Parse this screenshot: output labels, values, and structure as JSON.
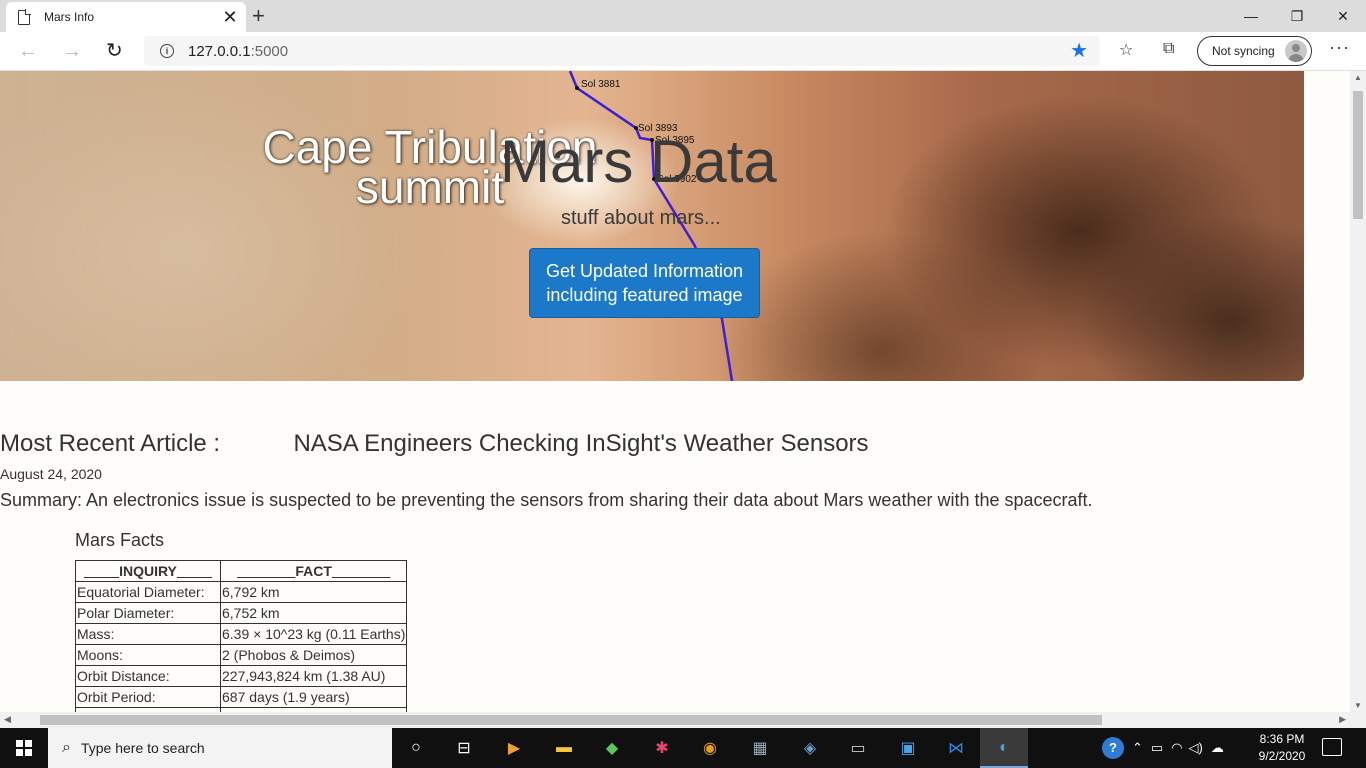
{
  "browser": {
    "tab_title": "Mars Info",
    "tab_close": "✕",
    "new_tab": "+",
    "window_controls": {
      "minimize": "—",
      "restore": "❐",
      "close": "✕"
    },
    "url_host": "127.0.0.1",
    "url_port": ":5000",
    "sync_label": "Not syncing",
    "icons": [
      "back-icon",
      "forward-icon",
      "refresh-icon",
      "info-icon",
      "star-icon",
      "favorites-icon",
      "collections-icon",
      "avatar",
      "more-icon"
    ]
  },
  "hero": {
    "overlay_line1": "Cape Tribulation",
    "overlay_line2": "summit",
    "title": "Mars Data",
    "subtitle": "stuff about mars...",
    "button_line1": "Get Updated Information",
    "button_line2": "including featured image",
    "sol_labels": [
      "Sol 3881",
      "Sol 3893",
      "Sol 3895",
      "Sol 3902"
    ],
    "path_color": "#3d1fd6",
    "button_color": "#1c78c8"
  },
  "article": {
    "label": "Most Recent Article :",
    "title": "NASA Engineers Checking InSight's Weather Sensors",
    "date": "August 24, 2020",
    "summary": "Summary: An electronics issue is suspected to be preventing the sensors from sharing their data about Mars weather with the spacecraft."
  },
  "facts": {
    "title": "Mars Facts",
    "headers": [
      "INQUIRY",
      "FACT"
    ],
    "rows": [
      {
        "inquiry": "Equatorial Diameter:",
        "fact": "6,792 km"
      },
      {
        "inquiry": "Polar Diameter:",
        "fact": "6,752 km"
      },
      {
        "inquiry": "Mass:",
        "fact": "6.39 × 10^23 kg (0.11 Earths)"
      },
      {
        "inquiry": "Moons:",
        "fact": "2 (Phobos & Deimos)"
      },
      {
        "inquiry": "Orbit Distance:",
        "fact": "227,943,824 km (1.38 AU)"
      },
      {
        "inquiry": "Orbit Period:",
        "fact": "687 days (1.9 years)"
      }
    ]
  },
  "taskbar": {
    "search_placeholder": "Type here to search",
    "time": "8:36 PM",
    "date": "9/2/2020"
  }
}
